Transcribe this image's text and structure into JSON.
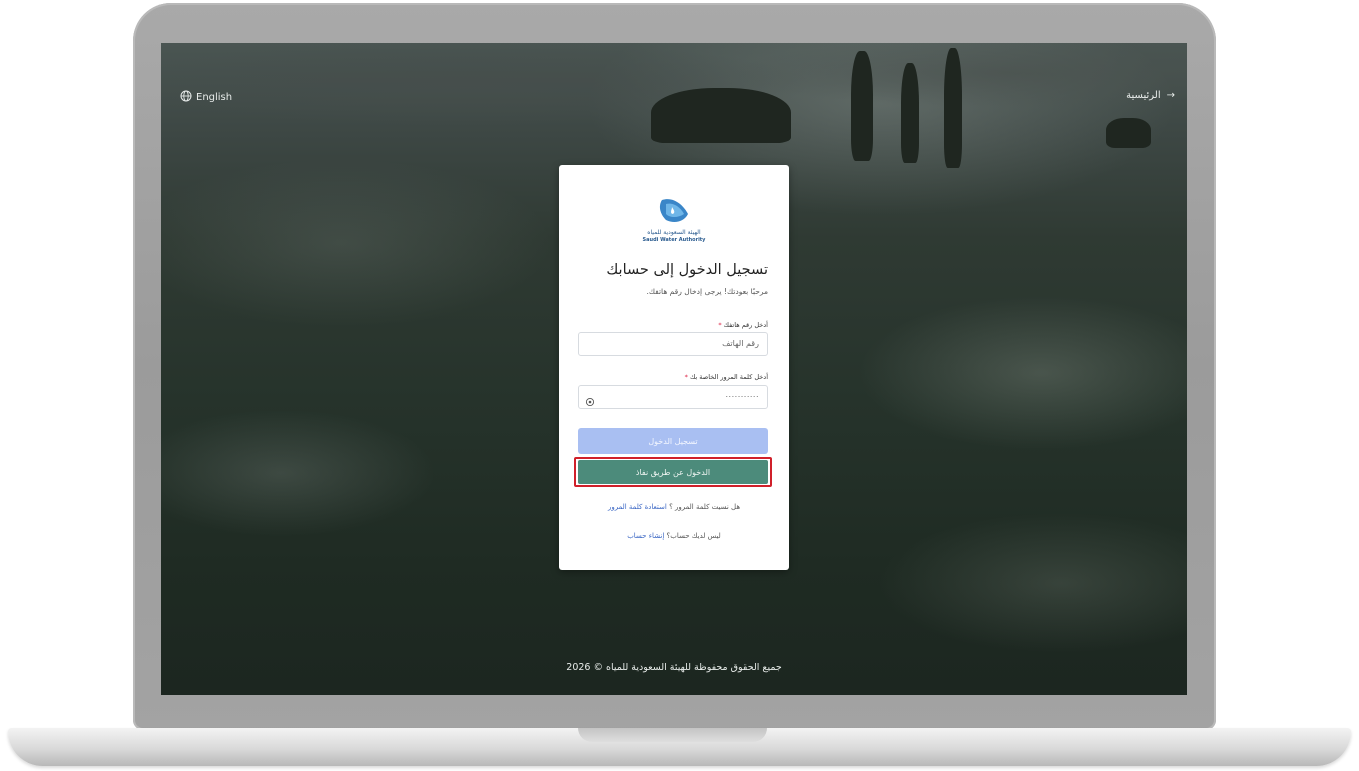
{
  "nav": {
    "home_label": "الرئيسية",
    "home_arrow": "→",
    "language_label": "English"
  },
  "logo": {
    "name_ar": "الهيئة السعودية للمياه",
    "name_en": "Saudi Water Authority"
  },
  "login": {
    "title": "تسجيل الدخول إلى حسابك",
    "subtitle": "مرحبًا بعودتك! يرجى إدخال رقم هاتفك.",
    "phone_label": "أدخل رقم هاتفك",
    "phone_placeholder": "رقم الهاتف",
    "password_label": "أدخل كلمة المرور الخاصة بك",
    "password_value": "...........",
    "required_mark": "*",
    "login_button": "تسجيل الدخول",
    "nafath_button": "الدخول عن طريق نفاذ",
    "forgot_text": "هل نسيت كلمة المرور ؟",
    "forgot_link": "استعادة كلمة المرور",
    "no_account_text": "ليس لديك حساب؟",
    "register_link": "إنشاء حساب"
  },
  "footer": {
    "copyright": "جميع الحقوق محفوظة للهيئة السعودية للمياه © 2026"
  },
  "colors": {
    "login_button_bg": "#a9bff2",
    "nafath_button_bg": "#4c8b7b",
    "highlight_border": "#d0202a",
    "link": "#3a66c4"
  }
}
